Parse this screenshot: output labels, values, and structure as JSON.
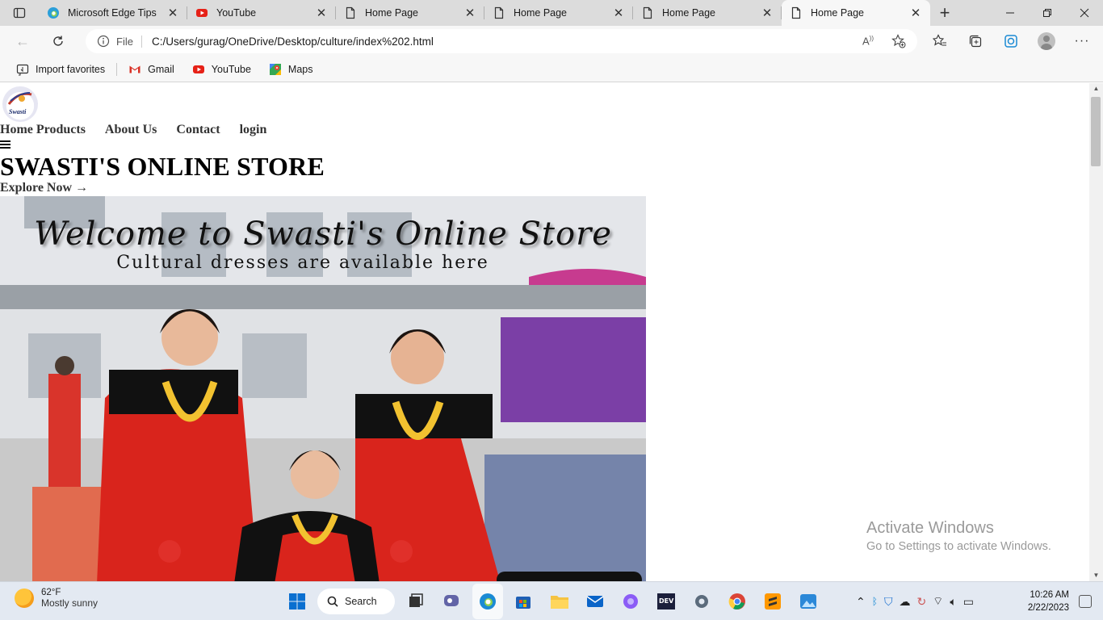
{
  "browser": {
    "tabs": [
      {
        "title": "Microsoft Edge Tips",
        "icon": "edge-icon",
        "active": false
      },
      {
        "title": "YouTube",
        "icon": "youtube-icon",
        "active": false
      },
      {
        "title": "Home Page",
        "icon": "page-icon",
        "active": false
      },
      {
        "title": "Home Page",
        "icon": "page-icon",
        "active": false
      },
      {
        "title": "Home Page",
        "icon": "page-icon",
        "active": false
      },
      {
        "title": "Home Page",
        "icon": "page-icon",
        "active": true
      }
    ],
    "address": {
      "scheme_label": "File",
      "url": "C:/Users/gurag/OneDrive/Desktop/culture/index%202.html"
    },
    "favorites": [
      {
        "label": "Import favorites",
        "icon": "import-icon"
      },
      {
        "label": "Gmail",
        "icon": "gmail-icon"
      },
      {
        "label": "YouTube",
        "icon": "youtube-icon"
      },
      {
        "label": "Maps",
        "icon": "maps-icon"
      }
    ]
  },
  "page": {
    "logo_text": "Swasti",
    "nav": [
      "Home",
      "Products",
      "About Us",
      "Contact",
      "login"
    ],
    "title": "SWASTI'S ONLINE STORE",
    "cta": "Explore Now →",
    "hero": {
      "headline": "Welcome to Swasti's Online Store",
      "subline": "Cultural dresses are available here"
    }
  },
  "watermark": {
    "title": "Activate Windows",
    "subtitle": "Go to Settings to activate Windows."
  },
  "taskbar": {
    "weather_temp": "62°F",
    "weather_desc": "Mostly sunny",
    "search_label": "Search",
    "time": "10:26 AM",
    "date": "2/22/2023"
  },
  "colors": {
    "tabstrip_bg": "#dcdcdc",
    "toolbar_bg": "#f7f7f7",
    "taskbar_bg": "#e3e9f2",
    "edge_blue": "#1a8ad4",
    "youtube_red": "#e62117"
  }
}
